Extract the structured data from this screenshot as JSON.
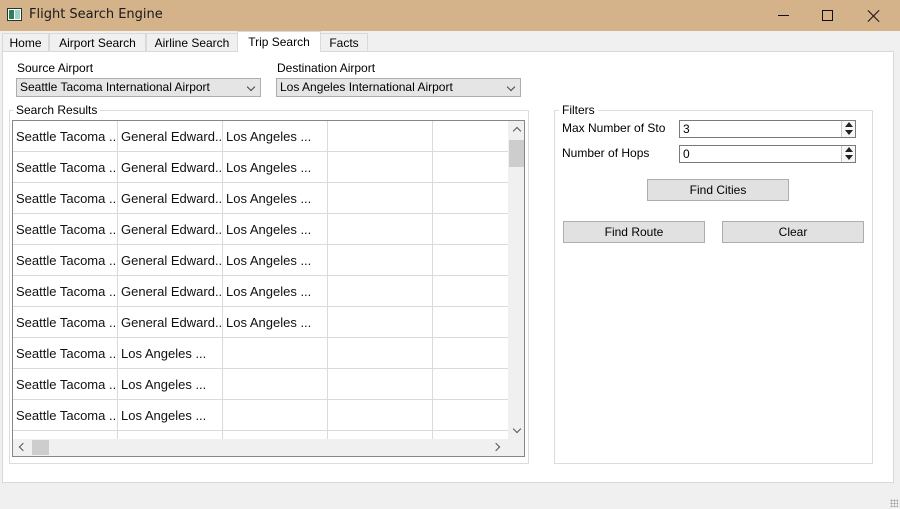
{
  "window": {
    "title": "Flight Search Engine",
    "icon": "app-icon",
    "controls": [
      "minimize-icon",
      "maximize-icon",
      "close-icon"
    ]
  },
  "tabs": [
    {
      "label": "Home",
      "active": false
    },
    {
      "label": "Airport Search",
      "active": false
    },
    {
      "label": "Airline Search",
      "active": false
    },
    {
      "label": "Trip Search",
      "active": true
    },
    {
      "label": "Facts",
      "active": false
    }
  ],
  "trip_search": {
    "source_label": "Source Airport",
    "source_value": "Seattle Tacoma International Airport",
    "destination_label": "Destination Airport",
    "destination_value": "Los Angeles International Airport",
    "results_title": "Search Results",
    "results_rows": [
      [
        "Seattle Tacoma ...",
        "General Edward...",
        "Los Angeles ...",
        "",
        ""
      ],
      [
        "Seattle Tacoma ...",
        "General Edward...",
        "Los Angeles ...",
        "",
        ""
      ],
      [
        "Seattle Tacoma ...",
        "General Edward...",
        "Los Angeles ...",
        "",
        ""
      ],
      [
        "Seattle Tacoma ...",
        "General Edward...",
        "Los Angeles ...",
        "",
        ""
      ],
      [
        "Seattle Tacoma ...",
        "General Edward...",
        "Los Angeles ...",
        "",
        ""
      ],
      [
        "Seattle Tacoma ...",
        "General Edward...",
        "Los Angeles ...",
        "",
        ""
      ],
      [
        "Seattle Tacoma ...",
        "General Edward...",
        "Los Angeles ...",
        "",
        ""
      ],
      [
        "Seattle Tacoma ...",
        "Los Angeles ...",
        "",
        "",
        ""
      ],
      [
        "Seattle Tacoma ...",
        "Los Angeles ...",
        "",
        "",
        ""
      ],
      [
        "Seattle Tacoma ...",
        "Los Angeles ...",
        "",
        "",
        ""
      ],
      [
        "",
        "",
        "",
        "",
        ""
      ]
    ],
    "filters": {
      "title": "Filters",
      "max_stops_label": "Max Number of Stops",
      "max_stops_value": "3",
      "hops_label": "Number of Hops",
      "hops_value": "0",
      "find_cities_label": "Find Cities",
      "find_route_label": "Find Route",
      "clear_label": "Clear"
    }
  }
}
